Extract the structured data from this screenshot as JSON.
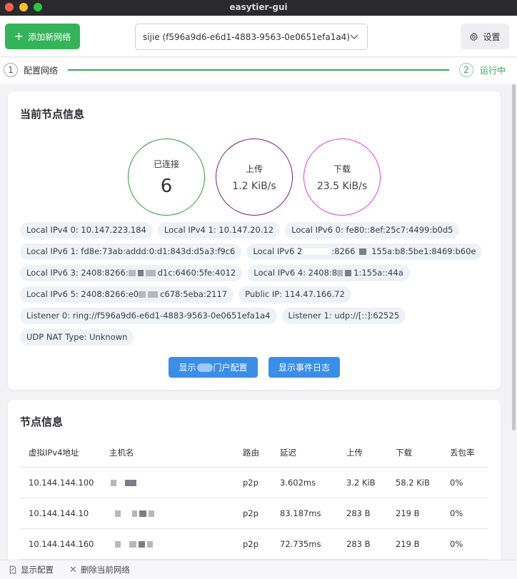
{
  "app": {
    "title": "easytier-gui"
  },
  "toolbar": {
    "add_network_label": "添加新网络",
    "network_select_value": "sijie (f596a9d6-e6d1-4883-9563-0e0651efa1a4)",
    "settings_label": "设置"
  },
  "stepper": {
    "step1": {
      "num": "1",
      "label": "配置网络"
    },
    "step2": {
      "num": "2",
      "label": "运行中"
    },
    "active_color": "#37a55e"
  },
  "node_info": {
    "title": "当前节点信息",
    "stats": [
      {
        "label": "已连接",
        "value": "6",
        "color": "#2e9a3e"
      },
      {
        "label": "上传",
        "value": "1.2 KiB/s",
        "color": "#7a1f7a"
      },
      {
        "label": "下载",
        "value": "23.5 KiB/s",
        "color": "#e43ce4"
      }
    ],
    "chips": [
      "Local IPv4 0: 10.147.223.184",
      "Local IPv4 1: 10.147.20.12",
      "Local IPv6 0: fe80::8ef:25c7:4499:b0d5",
      "Local IPv6 1: fd8e:73ab:addd:0:d1:843d:d5a3:f9c6",
      "Local IPv6 2",
      "Local IPv6 3: 2408:8266:",
      "Local IPv6 4: 2408:8",
      "Local IPv6 5: 2408:8266:e0",
      "Public IP: 114.47.166.72",
      "Listener 0: ring://f596a9d6-e6d1-4883-9563-0e0651efa1a4",
      "Listener 1: udp://[::]:62525",
      "UDP NAT Type: Unknown"
    ],
    "chip_fragments": {
      "ipv6_2_mid": ":8266",
      "ipv6_2_end": "155a:b8:5be1:8469:b60e",
      "ipv6_3_end": "d1c:6460:5fe:4012",
      "ipv6_4_end": "1:155a::44a",
      "ipv6_5_end": "c678:5eba:2117"
    },
    "show_portal_label_a": "显示",
    "show_portal_label_b": "门户配置",
    "show_events_label": "显示事件日志",
    "accent_color": "#3a8ee6"
  },
  "peers": {
    "title": "节点信息",
    "columns": [
      "虚拟IPv4地址",
      "主机名",
      "路由",
      "延迟",
      "上传",
      "下载",
      "丢包率"
    ],
    "rows": [
      {
        "ip": "10.144.144.100",
        "route": "p2p",
        "latency": "3.602ms",
        "up": "3.2 KiB",
        "down": "58.2 KiB",
        "loss": "0%"
      },
      {
        "ip": "10.144.144.10",
        "route": "p2p",
        "latency": "83.187ms",
        "up": "283 B",
        "down": "219 B",
        "loss": "0%"
      },
      {
        "ip": "10.144.144.160",
        "route": "p2p",
        "latency": "72.735ms",
        "up": "283 B",
        "down": "219 B",
        "loss": "0%"
      }
    ]
  },
  "bottombar": {
    "show_config_label": "显示配置",
    "delete_network_label": "删除当前网络"
  }
}
